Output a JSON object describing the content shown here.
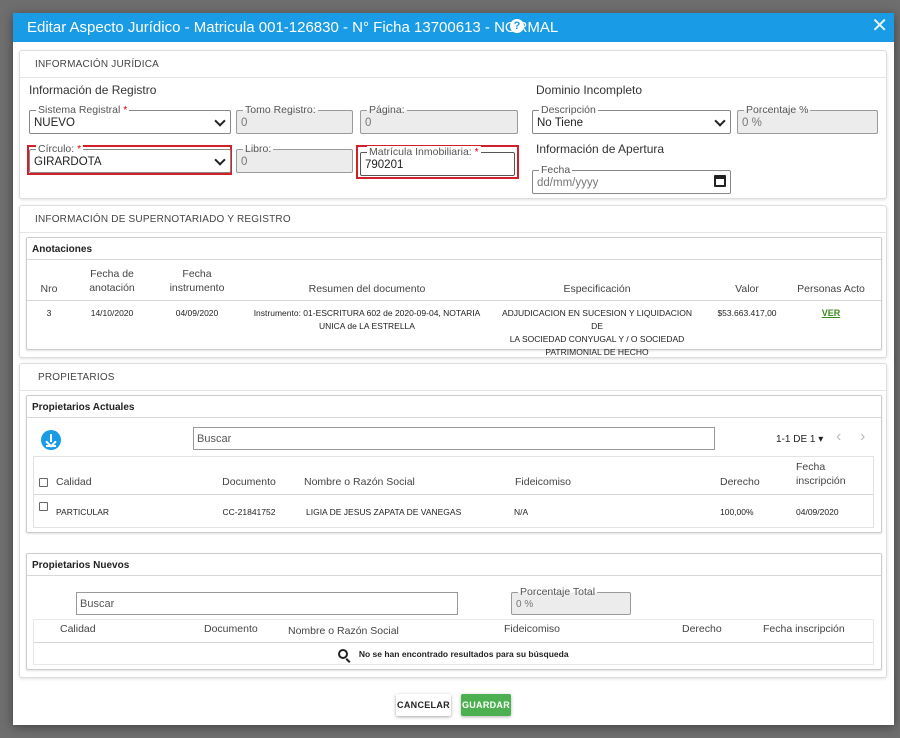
{
  "modal": {
    "title": "Editar Aspecto Jurídico - Matricula 001-126830 - N° Ficha 13700613 - NORMAL",
    "help_icon": "?",
    "close_icon": "✕"
  },
  "juridica": {
    "section_title": "INFORMACIÓN JURÍDICA",
    "registro_heading": "Información de Registro",
    "sistema_registral": {
      "label": "Sistema Registral",
      "required": "*",
      "value": "NUEVO"
    },
    "tomo_registro": {
      "label": "Tomo Registro:",
      "value": "0"
    },
    "pagina": {
      "label": "Página:",
      "value": "0"
    },
    "circulo": {
      "label": "Círculo:",
      "required": "*",
      "value": "GIRARDOTA"
    },
    "libro": {
      "label": "Libro:",
      "value": "0"
    },
    "matricula": {
      "label": "Matrícula Inmobiliaria:",
      "required": "*",
      "value": "790201"
    },
    "dominio_heading": "Dominio Incompleto",
    "descripcion": {
      "label": "Descripción",
      "value": "No Tiene"
    },
    "porcentaje": {
      "label": "Porcentaje %",
      "value": "0 %"
    },
    "apertura_heading": "Información de Apertura",
    "fecha": {
      "label": "Fecha",
      "placeholder": "dd/mm/yyyy"
    }
  },
  "supernotariado": {
    "section_title": "INFORMACIÓN DE SUPERNOTARIADO Y REGISTRO",
    "card_title": "Anotaciones",
    "headers": {
      "nro": "Nro",
      "fecha_anotacion_1": "Fecha de",
      "fecha_anotacion_2": "anotación",
      "fecha_instrumento_1": "Fecha",
      "fecha_instrumento_2": "instrumento",
      "resumen": "Resumen del documento",
      "especificacion": "Especificación",
      "valor": "Valor",
      "personas": "Personas Acto"
    },
    "rows": [
      {
        "nro": "3",
        "fecha_anotacion": "14/10/2020",
        "fecha_instrumento": "04/09/2020",
        "resumen_1": "Instrumento: 01-ESCRITURA 602 de 2020-09-04, NOTARIA",
        "resumen_2": "UNICA de LA ESTRELLA",
        "especificacion_1": "ADJUDICACION EN SUCESION Y LIQUIDACION DE",
        "especificacion_2": "LA SOCIEDAD CONYUGAL Y / O SOCIEDAD",
        "especificacion_3": "PATRIMONIAL DE HECHO",
        "valor": "$53.663.417,00",
        "personas": "VER"
      }
    ]
  },
  "propietarios": {
    "section_title": "PROPIETARIOS",
    "actuales": {
      "card_title": "Propietarios Actuales",
      "search_placeholder": "Buscar",
      "pagination": "1-1 DE 1",
      "prev_icon": "‹",
      "next_icon": "›",
      "headers": {
        "calidad": "Calidad",
        "documento": "Documento",
        "nombre": "Nombre o Razón Social",
        "fideicomiso": "Fideicomiso",
        "derecho": "Derecho",
        "fecha_1": "Fecha",
        "fecha_2": "inscripción"
      },
      "rows": [
        {
          "calidad": "PARTICULAR",
          "documento": "CC-21841752",
          "nombre": "LIGIA DE JESUS ZAPATA DE VANEGAS",
          "fideicomiso": "N/A",
          "derecho": "100,00%",
          "fecha": "04/09/2020"
        }
      ]
    },
    "nuevos": {
      "card_title": "Propietarios Nuevos",
      "search_placeholder": "Buscar",
      "porcentaje_total": {
        "label": "Porcentaje Total",
        "value": "0 %"
      },
      "headers": {
        "calidad": "Calidad",
        "documento": "Documento",
        "nombre": "Nombre o Razón Social",
        "fideicomiso": "Fideicomiso",
        "derecho": "Derecho",
        "fecha": "Fecha inscripción"
      },
      "empty_message": "No se han encontrado resultados para su búsqueda"
    }
  },
  "footer": {
    "cancel_label": "CANCELAR",
    "save_label": "GUARDAR"
  }
}
